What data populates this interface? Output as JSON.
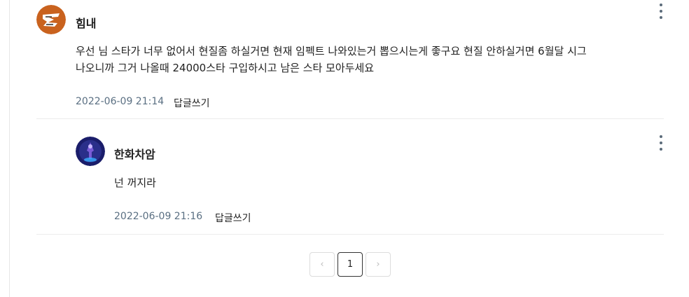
{
  "comments": [
    {
      "author": "힘내",
      "text_line1": "우선 님 스타가 너무 없어서 현질좀 하실거면 현재 임펙트 나와있는거 뽑으시는게 좋구요 현질 안하실거면 6월달 시그",
      "text_line2": "나오니까 그거 나올때 24000스타 구입하시고 남은 스타 모아두세요",
      "timestamp": "2022-06-09 21:14",
      "reply_label": "답글쓰기",
      "avatar_icon": "tiger-logo-icon",
      "avatar_color": "#c9621e"
    },
    {
      "author": "한화차암",
      "text": "넌 꺼지라",
      "timestamp": "2022-06-09 21:16",
      "reply_label": "답글쓰기",
      "avatar_icon": "character-avatar-icon",
      "avatar_color": "#1a1d6a"
    }
  ],
  "pagination": {
    "prev": "‹",
    "current": "1",
    "next": "›"
  }
}
